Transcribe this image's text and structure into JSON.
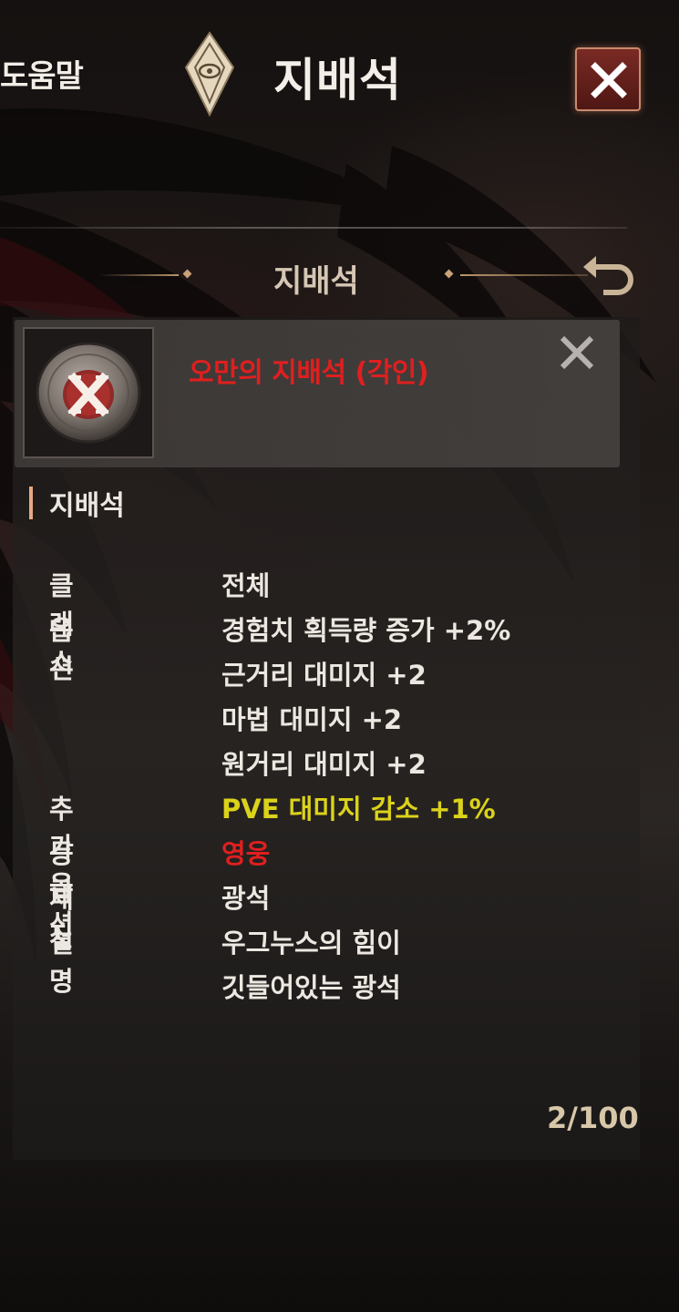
{
  "header": {
    "help_label": "도움말",
    "title": "지배석"
  },
  "section": {
    "title": "지배석"
  },
  "item": {
    "name": "오만의 지배석 (각인)",
    "icon": "x-rune-stone-icon",
    "name_color": "#e01f1f"
  },
  "category": {
    "label": "지배석"
  },
  "properties": {
    "class_label": "클래스",
    "class_value": "전체",
    "option_label": "옵션",
    "options": [
      "경험치 획득량 증가 +2%",
      "근거리 대미지 +2",
      "마법 대미지 +2",
      "원거리 대미지 +2"
    ],
    "extra_option_label": "추가 옵션",
    "extra_option_value": "PVE 대미지 감소 +1%",
    "grade_label": "등급",
    "grade_value": "영웅",
    "material_label": "재질",
    "material_value": "광석",
    "description_label": "설명",
    "description_lines": [
      "우그누스의 힘이",
      "깃들어있는 광석"
    ]
  },
  "footer": {
    "page_count": "2/100"
  },
  "colors": {
    "extra_option": "#dbd21a",
    "grade": "#e01f1f",
    "accent_bar": "#e4a984"
  }
}
